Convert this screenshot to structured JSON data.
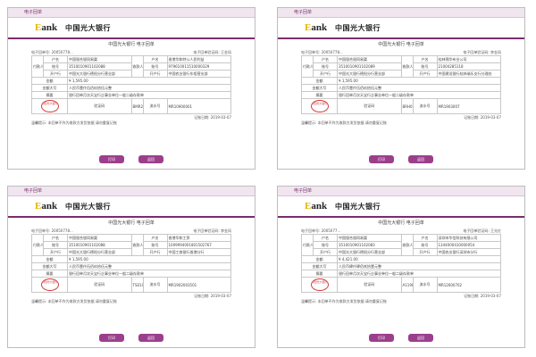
{
  "panels": [
    {
      "tab": "电子回单",
      "logo_letter": "E",
      "logo_rest": "ank",
      "bank_name": "中国光大银行",
      "receipt_title": "中国光大银行 电子回单",
      "serial_label": "电子回单号: ",
      "serial": "20050778...",
      "verify": "电子回单验证码: 王金凤",
      "payer_side": "付款人",
      "payee_side": "收款人",
      "rows": [
        {
          "l1": "户名",
          "v1": "中国银合银同易渠",
          "l2": "户名",
          "v2": "香港华和特公人民利益"
        },
        {
          "l1": "账号",
          "v1": "3510010901102088",
          "l2": "账号",
          "v2": "979610011510000329"
        },
        {
          "l1": "开户行",
          "v1": "中国光大银行德阳分行营业部",
          "l2": "开户行",
          "v2": "中国农业银行东梧营业部"
        }
      ],
      "amount_label": "金额",
      "amount": "¥ 1,595.00",
      "words_label": "金额大写",
      "words": "人民币壹仟伍佰玖拾伍元整",
      "memo_label": "摘要",
      "memo": "银行回单月次天宝行企事业单位一般二级存款单",
      "code_label": "验证码",
      "code": "BMR2100011010884",
      "flow_label": "流水号",
      "flow": "MR10900001",
      "stamp": "中国光大银行 电子回单专用章",
      "date": "记账日期: 2019-03-07",
      "note": "温馨提示: 本回单不作为收款方发货依据 请勿重复记账",
      "btn_print": "打印",
      "btn_back": "返回"
    },
    {
      "tab": "电子回单",
      "logo_letter": "E",
      "logo_rest": "ank",
      "bank_name": "中国光大银行",
      "receipt_title": "中国光大银行 电子回单",
      "serial_label": "电子回单号: ",
      "serial": "20050778...",
      "verify": "电子回单验证码: 李金凤",
      "payer_side": "付款人",
      "payee_side": "收款人",
      "rows": [
        {
          "l1": "户名",
          "v1": "中国银合银同易渠",
          "l2": "户名",
          "v2": "桂林锦华布业公司"
        },
        {
          "l1": "账号",
          "v1": "3510010901102089",
          "l2": "账号",
          "v2": "21004285118"
        },
        {
          "l1": "开户行",
          "v1": "中国光大银行德阳分行营业部",
          "l2": "开户行",
          "v2": "中国建设银行桂林瑞乐支行分理处"
        }
      ],
      "amount_label": "金额",
      "amount": "¥ 1,595.00",
      "words_label": "金额大写",
      "words": "人民币壹仟伍佰玖拾伍元整",
      "memo_label": "摘要",
      "memo": "银行回单月次天宝行企事业单位一般二级存款单",
      "code_label": "验证码",
      "code": "BRH0180901000",
      "flow_label": "流水号",
      "flow": "MR1903007",
      "stamp": "中国光大银行 电子回单专用章",
      "date": "记账日期: 2019-03-07",
      "note": "温馨提示: 本回单不作为收款方发货依据 请勿重复记账",
      "btn_print": "打印",
      "btn_back": "返回"
    },
    {
      "tab": "电子回单",
      "logo_letter": "E",
      "logo_rest": "ank",
      "bank_name": "中国光大银行",
      "receipt_title": "中国光大银行 电子回单",
      "serial_label": "电子回单号: ",
      "serial": "20050778...",
      "verify": "电子回单验证码: 李金凤",
      "payer_side": "付款人",
      "payee_side": "收款人",
      "rows": [
        {
          "l1": "户名",
          "v1": "中国银合银同易渠",
          "l2": "户名",
          "v2": "香港华和工贸"
        },
        {
          "l1": "账号",
          "v1": "3510010901102088",
          "l2": "账号",
          "v2": "1009994001801502767"
        },
        {
          "l1": "开户行",
          "v1": "中国光大银行德阳分行营业部",
          "l2": "开户行",
          "v2": "中国工商银行香港分行"
        }
      ],
      "amount_label": "金额",
      "amount": "¥ 1,595.00",
      "words_label": "金额大写",
      "words": "人民币壹仟伍佰玖拾伍元整",
      "memo_label": "摘要",
      "memo": "银行回单月次天宝行企事业单位一般二级存款单",
      "code_label": "验证码",
      "code": "TS01001200900401",
      "flow_label": "流水号",
      "flow": "MR1902003501",
      "stamp": "中国光大银行 电子回单专用章",
      "date": "记账日期: 2019-03-07",
      "note": "温馨提示: 本回单不作为收款方发货依据 请勿重复记账",
      "btn_print": "打印",
      "btn_back": "返回"
    },
    {
      "tab": "电子回单",
      "logo_letter": "E",
      "logo_rest": "ank",
      "bank_name": "中国光大银行",
      "receipt_title": "中国光大银行 电子回单",
      "serial_label": "电子回单号: ",
      "serial": "2005077...",
      "verify": "电子回单验证码: 王光红",
      "payer_side": "付款人",
      "payee_side": "收款人",
      "rows": [
        {
          "l1": "户名",
          "v1": "中国银合银同易渠",
          "l2": "户名",
          "v2": "深圳市华信科技有限公司"
        },
        {
          "l1": "账号",
          "v1": "3510010901102083",
          "l2": "账号",
          "v2": "1344000410000054"
        },
        {
          "l1": "开户行",
          "v1": "中国光大银行德阳分行营业部",
          "l2": "开户行",
          "v2": "中国农业银行深圳市分行"
        }
      ],
      "amount_label": "金额",
      "amount": "¥ 4,421.00",
      "words_label": "金额大写",
      "words": "人民币肆仟肆佰贰拾壹元整",
      "memo_label": "摘要",
      "memo": "银行回单月次天宝行企事业单位一般二级存款单",
      "code_label": "验证码",
      "code": "A1190011400152",
      "flow_label": "流水号",
      "flow": "MR12600702",
      "stamp": "中国光大银行 电子回单专用章",
      "date": "记账日期: 2019-03-07",
      "note": "温馨提示: 本回单不作为收款方发货依据 请勿重复记账",
      "btn_print": "打印",
      "btn_back": "返回"
    }
  ]
}
